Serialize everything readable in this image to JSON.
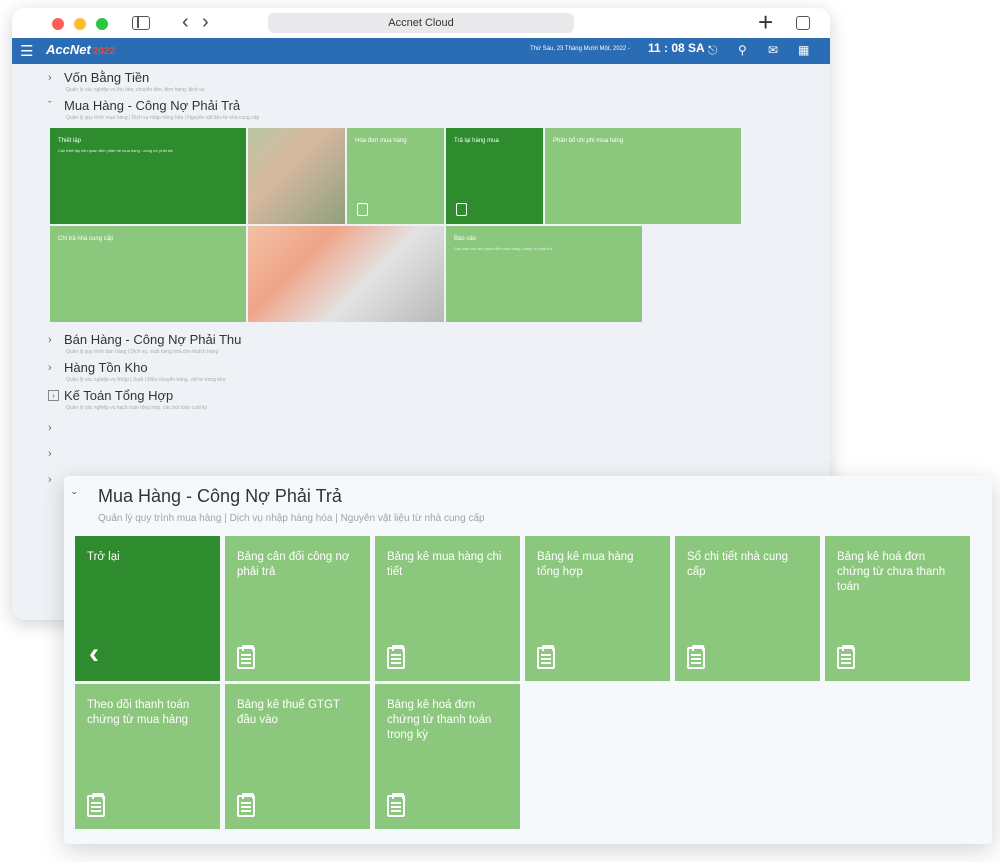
{
  "browser": {
    "title": "Accnet Cloud"
  },
  "appbar": {
    "logo": "AccNet",
    "logo_badge": "2022",
    "datetime": "Thứ Sáu, 23 Tháng Mười Một, 2022 -",
    "time": "11 : 08 SA"
  },
  "back": {
    "groups": [
      {
        "title": "Vốn Bằng Tiền",
        "subtitle": "Quản lý các nghiệp vụ thu tiền, chuyển tiền, đơn hàng, dịch vụ"
      },
      {
        "title": "Mua Hàng - Công Nợ Phải Trả",
        "subtitle": "Quản lý quy trình mua hàng | Dịch vụ nhập hàng hóa | Nguyên vật liệu từ nhà cung cấp"
      }
    ],
    "tiles": [
      {
        "label": "Thiết lập",
        "desc": "Các thiết lập liên quan đến phân hệ mua hàng - công nợ phải trả"
      },
      {
        "label": "Hóa đơn mua hàng"
      },
      {
        "label": "Trả lại hàng mua"
      },
      {
        "label": "Phân bổ chi phí mua hàng"
      },
      {
        "label": "Chi trả nhà cung cấp"
      },
      {
        "label": "Báo cáo",
        "desc": "Các báo cáo liên quan đến mua hàng, công nợ phải trả"
      }
    ],
    "groups_after": [
      {
        "title": "Bán Hàng - Công Nợ Phải Thu",
        "subtitle": "Quản lý quy trình bán hàng | Dịch vụ, xuất hàng hóa cho khách hàng"
      },
      {
        "title": "Hàng Tồn Kho",
        "subtitle": "Quản lý các nghiệp vụ Nhập | Xuất | Điều chuyển hàng, vật tư trong kho"
      },
      {
        "title": "Kế Toán Tổng Hợp",
        "subtitle": "Quản lý các nghiệp vụ hạch toán tổng hợp, các bút toán cuối kỳ"
      }
    ]
  },
  "front": {
    "title": "Mua Hàng - Công Nợ Phải Trả",
    "subtitle": "Quản lý quy trình mua hàng | Dịch vụ nhập hàng hóa | Nguyên vật liệu từ nhà cung cấp",
    "tiles": [
      {
        "label": "Trở lại"
      },
      {
        "label": "Bảng cân đối công nợ phải trả"
      },
      {
        "label": "Bảng kê mua hàng chi tiết"
      },
      {
        "label": "Bảng kê mua hàng tổng hợp"
      },
      {
        "label": "Sổ chi tiết nhà cung cấp"
      },
      {
        "label": "Bảng kê hoá đơn chứng từ chưa thanh toán"
      },
      {
        "label": "Theo dõi thanh toán chứng từ mua hàng"
      },
      {
        "label": "Bảng kê thuế GTGT đầu vào"
      },
      {
        "label": "Bảng kê hoá đơn chứng từ thanh toán trong kỳ"
      }
    ]
  }
}
